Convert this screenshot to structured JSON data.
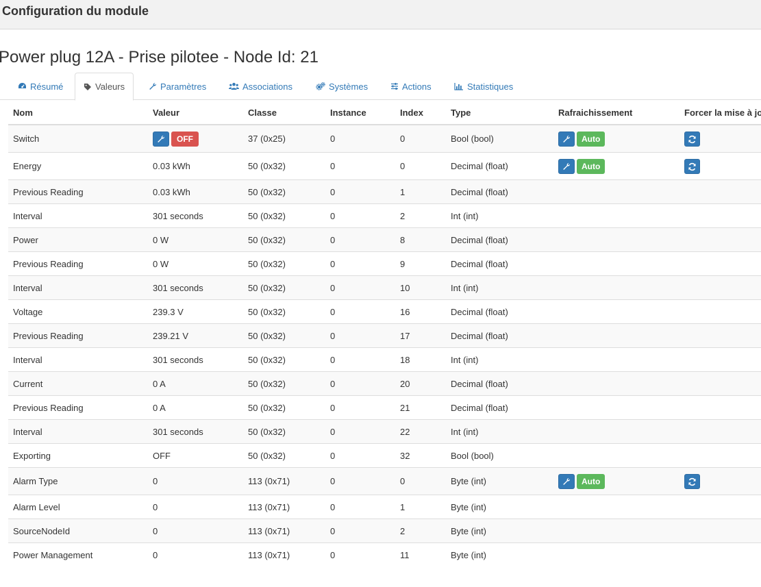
{
  "modal": {
    "title": "Configuration du module"
  },
  "node_title": "Power plug 12A - Prise pilotee - Node Id: 21",
  "tabs": [
    {
      "label": "Résumé",
      "icon": "dashboard-icon",
      "active": false
    },
    {
      "label": "Valeurs",
      "icon": "tag-icon",
      "active": true
    },
    {
      "label": "Paramètres",
      "icon": "wrench-icon",
      "active": false
    },
    {
      "label": "Associations",
      "icon": "users-icon",
      "active": false
    },
    {
      "label": "Systèmes",
      "icon": "cogs-icon",
      "active": false
    },
    {
      "label": "Actions",
      "icon": "sliders-icon",
      "active": false
    },
    {
      "label": "Statistiques",
      "icon": "bar-chart-icon",
      "active": false
    }
  ],
  "table": {
    "headers": [
      "Nom",
      "Valeur",
      "Classe",
      "Instance",
      "Index",
      "Type",
      "Rafraichissement",
      "Forcer la mise à jour"
    ],
    "buttons": {
      "off_label": "OFF",
      "auto_label": "Auto"
    },
    "rows": [
      {
        "nom": "Switch",
        "valeur": "",
        "classe": "37 (0x25)",
        "instance": "0",
        "index": "0",
        "type": "Bool (bool)",
        "value_controls": true,
        "refresh_controls": true
      },
      {
        "nom": "Energy",
        "valeur": "0.03 kWh",
        "classe": "50 (0x32)",
        "instance": "0",
        "index": "0",
        "type": "Decimal (float)",
        "value_controls": false,
        "refresh_controls": true
      },
      {
        "nom": "Previous Reading",
        "valeur": "0.03 kWh",
        "classe": "50 (0x32)",
        "instance": "0",
        "index": "1",
        "type": "Decimal (float)",
        "value_controls": false,
        "refresh_controls": false
      },
      {
        "nom": "Interval",
        "valeur": "301 seconds",
        "classe": "50 (0x32)",
        "instance": "0",
        "index": "2",
        "type": "Int (int)",
        "value_controls": false,
        "refresh_controls": false
      },
      {
        "nom": "Power",
        "valeur": "0 W",
        "classe": "50 (0x32)",
        "instance": "0",
        "index": "8",
        "type": "Decimal (float)",
        "value_controls": false,
        "refresh_controls": false
      },
      {
        "nom": "Previous Reading",
        "valeur": "0 W",
        "classe": "50 (0x32)",
        "instance": "0",
        "index": "9",
        "type": "Decimal (float)",
        "value_controls": false,
        "refresh_controls": false
      },
      {
        "nom": "Interval",
        "valeur": "301 seconds",
        "classe": "50 (0x32)",
        "instance": "0",
        "index": "10",
        "type": "Int (int)",
        "value_controls": false,
        "refresh_controls": false
      },
      {
        "nom": "Voltage",
        "valeur": "239.3 V",
        "classe": "50 (0x32)",
        "instance": "0",
        "index": "16",
        "type": "Decimal (float)",
        "value_controls": false,
        "refresh_controls": false
      },
      {
        "nom": "Previous Reading",
        "valeur": "239.21 V",
        "classe": "50 (0x32)",
        "instance": "0",
        "index": "17",
        "type": "Decimal (float)",
        "value_controls": false,
        "refresh_controls": false
      },
      {
        "nom": "Interval",
        "valeur": "301 seconds",
        "classe": "50 (0x32)",
        "instance": "0",
        "index": "18",
        "type": "Int (int)",
        "value_controls": false,
        "refresh_controls": false
      },
      {
        "nom": "Current",
        "valeur": "0 A",
        "classe": "50 (0x32)",
        "instance": "0",
        "index": "20",
        "type": "Decimal (float)",
        "value_controls": false,
        "refresh_controls": false
      },
      {
        "nom": "Previous Reading",
        "valeur": "0 A",
        "classe": "50 (0x32)",
        "instance": "0",
        "index": "21",
        "type": "Decimal (float)",
        "value_controls": false,
        "refresh_controls": false
      },
      {
        "nom": "Interval",
        "valeur": "301 seconds",
        "classe": "50 (0x32)",
        "instance": "0",
        "index": "22",
        "type": "Int (int)",
        "value_controls": false,
        "refresh_controls": false
      },
      {
        "nom": "Exporting",
        "valeur": "OFF",
        "classe": "50 (0x32)",
        "instance": "0",
        "index": "32",
        "type": "Bool (bool)",
        "value_controls": false,
        "refresh_controls": false
      },
      {
        "nom": "Alarm Type",
        "valeur": "0",
        "classe": "113 (0x71)",
        "instance": "0",
        "index": "0",
        "type": "Byte (int)",
        "value_controls": false,
        "refresh_controls": true
      },
      {
        "nom": "Alarm Level",
        "valeur": "0",
        "classe": "113 (0x71)",
        "instance": "0",
        "index": "1",
        "type": "Byte (int)",
        "value_controls": false,
        "refresh_controls": false
      },
      {
        "nom": "SourceNodeId",
        "valeur": "0",
        "classe": "113 (0x71)",
        "instance": "0",
        "index": "2",
        "type": "Byte (int)",
        "value_controls": false,
        "refresh_controls": false
      },
      {
        "nom": "Power Management",
        "valeur": "0",
        "classe": "113 (0x71)",
        "instance": "0",
        "index": "11",
        "type": "Byte (int)",
        "value_controls": false,
        "refresh_controls": false
      }
    ]
  },
  "colors": {
    "link": "#337ab7",
    "primary_button": "#337ab7",
    "danger": "#d9534f",
    "success": "#5cb85c",
    "stripe": "#f9f9f9",
    "header_bg": "#f2f2f2"
  }
}
